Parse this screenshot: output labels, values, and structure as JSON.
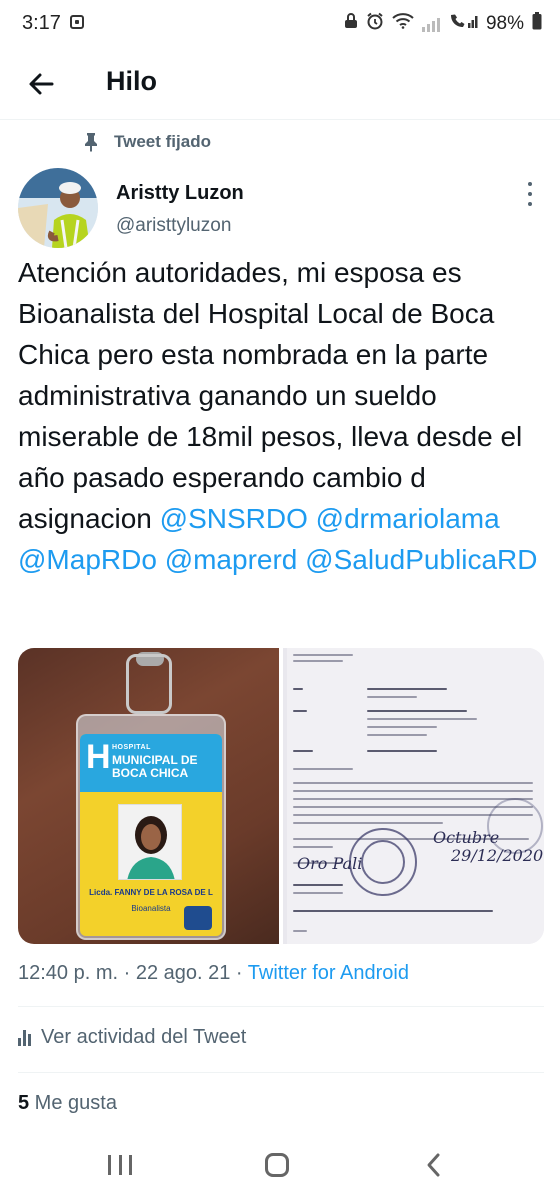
{
  "status_bar": {
    "time": "3:17",
    "battery": "98%",
    "icons": [
      "notification-icon",
      "lock-icon",
      "alarm-icon",
      "wifi-icon",
      "signal-icon",
      "call-signal-icon",
      "battery-icon"
    ]
  },
  "header": {
    "title": "Hilo",
    "back_icon": "arrow-left-icon"
  },
  "tweet": {
    "pinned_label": "Tweet fijado",
    "author_name": "Aristty Luzon",
    "author_handle": "@aristtyluzon",
    "text_plain": "Atención autoridades, mi esposa es Bioanalista del Hospital Local de Boca Chica pero esta nombrada en la parte administrativa ganando un sueldo miserable de 18mil pesos, lleva desde el año pasado esperando cambio d asignacion ",
    "mentions": [
      "@SNSRDO",
      "@drmariolama",
      "@MapRDo",
      "@maprerd",
      "@SaludPublicaRD"
    ],
    "badge": {
      "hospital": "HOSPITAL",
      "municipal": "MUNICIPAL DE BOCA CHICA",
      "name": "Licda. FANNY DE LA ROSA DE L",
      "role": "Bioanalista"
    },
    "timestamp": "12:40 p. m. · 22 ago. 21 · ",
    "source": "Twitter for Android",
    "activity_label": "Ver actividad del Tweet",
    "likes_count": "5",
    "likes_label": " Me gusta"
  },
  "colors": {
    "accent": "#1d9bf0",
    "text_primary": "#0f1419",
    "text_secondary": "#536471",
    "divider": "#eff3f4"
  }
}
